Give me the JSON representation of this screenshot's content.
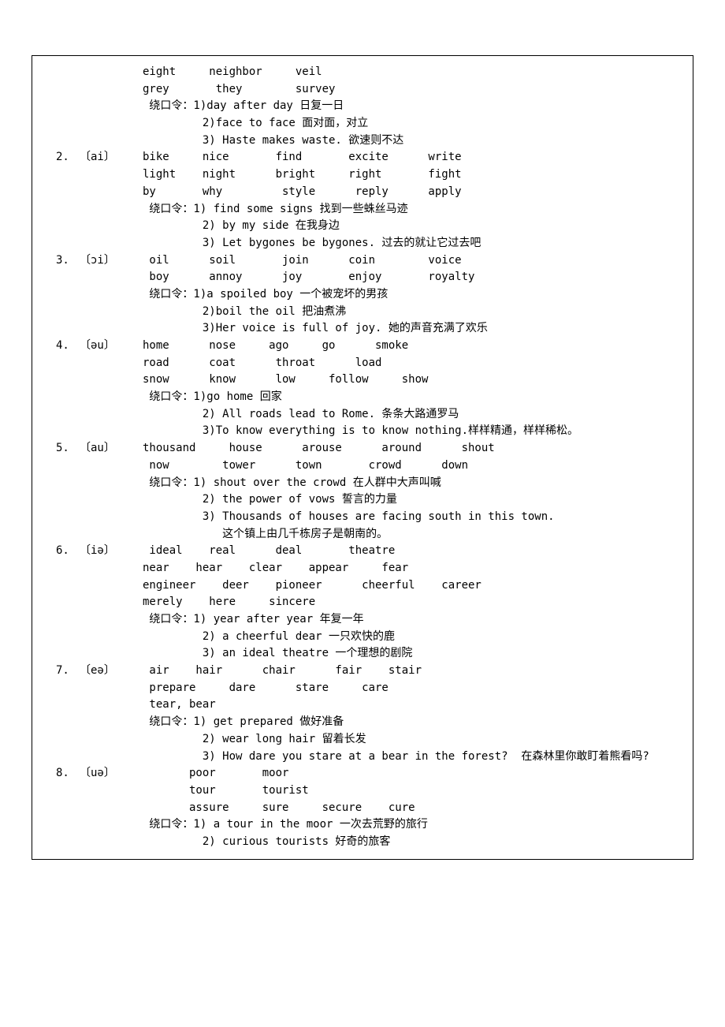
{
  "intro": [
    {
      "num": "",
      "sym": "",
      "lines": [
        "eight     neighbor     veil",
        "grey       they        survey",
        " 绕口令：1)day after day 日复一日",
        "         2)face to face 面对面，对立",
        "         3) Haste makes waste. 欲速则不达"
      ]
    }
  ],
  "sections": [
    {
      "num": "2.",
      "sym": "〔ai〕",
      "lines": [
        "bike     nice       find       excite      write",
        "light    night      bright     right       fight",
        "by       why         style      reply      apply",
        " 绕口令：1) find some signs 找到一些蛛丝马迹",
        "         2) by my side 在我身边",
        "         3) Let bygones be bygones. 过去的就让它过去吧"
      ]
    },
    {
      "num": "3.",
      "sym": "〔ɔi〕",
      "lines": [
        " oil      soil       join      coin        voice",
        " boy      annoy      joy       enjoy       royalty",
        " 绕口令：1)a spoiled boy 一个被宠坏的男孩",
        "         2)boil the oil 把油煮沸",
        "         3)Her voice is full of joy. 她的声音充满了欢乐"
      ]
    },
    {
      "num": "4.",
      "sym": "〔əu〕",
      "lines": [
        "home      nose     ago     go      smoke",
        "road      coat      throat      load",
        "snow      know      low     follow     show",
        " 绕口令：1)go home 回家",
        "         2) All roads lead to Rome. 条条大路通罗马",
        "         3)To know everything is to know nothing.样样精通，样样稀松。"
      ]
    },
    {
      "num": "5.",
      "sym": "〔au〕",
      "lines": [
        "thousand     house      arouse      around      shout",
        " now        tower      town       crowd      down",
        " 绕口令：1) shout over the crowd 在人群中大声叫喊",
        "         2) the power of vows 誓言的力量",
        "         3) Thousands of houses are facing south in this town.",
        "            这个镇上由几千栋房子是朝南的。"
      ]
    },
    {
      "num": "6.",
      "sym": "〔iə〕",
      "lines": [
        " ideal    real      deal       theatre",
        "near    hear    clear    appear     fear",
        "engineer    deer    pioneer      cheerful    career",
        "merely    here     sincere",
        " 绕口令：1) year after year 年复一年",
        "         2) a cheerful dear 一只欢快的鹿",
        "         3) an ideal theatre 一个理想的剧院"
      ]
    },
    {
      "num": "7.",
      "sym": "〔eə〕",
      "lines": [
        " air    hair      chair      fair    stair",
        " prepare     dare      stare     care",
        " tear, bear",
        " 绕口令：1) get prepared 做好准备",
        "         2) wear long hair 留着长发",
        "         3) How dare you stare at a bear in the forest?  在森林里你敢盯着熊看吗?"
      ]
    },
    {
      "num": "8.",
      "sym": "〔uə〕",
      "lines": [
        "       poor       moor",
        "       tour       tourist",
        "       assure     sure     secure    cure",
        " 绕口令：1) a tour in the moor 一次去荒野的旅行",
        "         2) curious tourists 好奇的旅客"
      ]
    }
  ]
}
